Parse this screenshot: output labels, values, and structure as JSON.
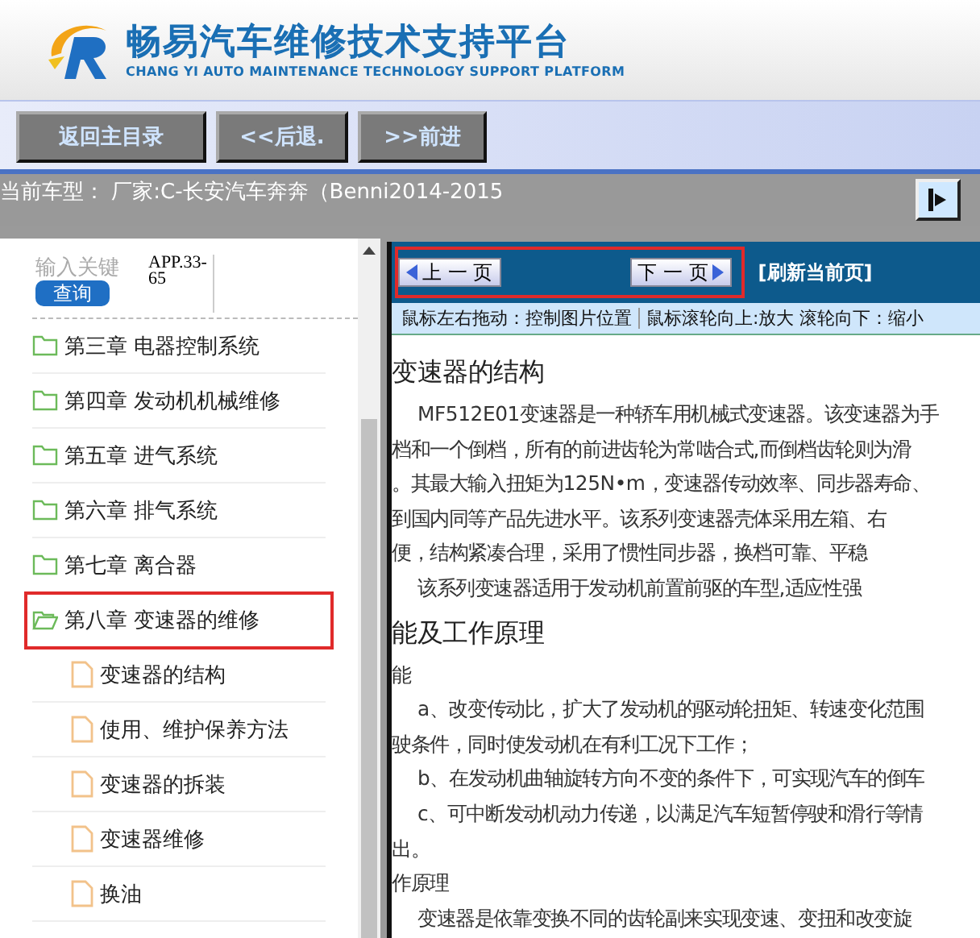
{
  "header": {
    "title": "畅易汽车维修技术支持平台",
    "subtitle": "CHANG YI AUTO MAINTENANCE TECHNOLOGY SUPPORT PLATFORM"
  },
  "nav_buttons": [
    "返回主目录",
    "<<后退.",
    ">>前进"
  ],
  "current_model": "当前车型：  厂家:C-长安汽车奔奔（Benni2014-2015",
  "search": {
    "placeholder": "输入关键",
    "button": "查询",
    "code": "APP.33-65"
  },
  "tree": [
    {
      "label": "第三章 电器控制系统",
      "expanded": false,
      "selected": false
    },
    {
      "label": "第四章 发动机机械维修",
      "expanded": false,
      "selected": false
    },
    {
      "label": "第五章 进气系统",
      "expanded": false,
      "selected": false
    },
    {
      "label": "第六章 排气系统",
      "expanded": false,
      "selected": false
    },
    {
      "label": "第七章 离合器",
      "expanded": false,
      "selected": false
    },
    {
      "label": "第八章 变速器的维修",
      "expanded": true,
      "selected": true,
      "children": [
        {
          "label": "变速器的结构"
        },
        {
          "label": "使用、维护保养方法"
        },
        {
          "label": "变速器的拆装"
        },
        {
          "label": "变速器维修"
        },
        {
          "label": "换油"
        }
      ]
    }
  ],
  "viewer": {
    "prev": "上 一 页",
    "next": "下 一 页",
    "pager_highlighted": true,
    "refresh": "[刷新当前页]",
    "hints": [
      "鼠标左右拖动：控制图片位置",
      "鼠标滚轮向上:放大  滚轮向下：缩小"
    ]
  },
  "document": [
    {
      "kind": "heading",
      "text": "变速器的结构"
    },
    {
      "kind": "indent",
      "text": "MF512E01变速器是一种轿车用机械式变速器。该变速器为手"
    },
    {
      "kind": "plain",
      "text": "档和一个倒档，所有的前进齿轮为常啮合式,而倒档齿轮则为滑"
    },
    {
      "kind": "plain",
      "text": "。其最大输入扭矩为125N•m，变速器传动效率、同步器寿命、"
    },
    {
      "kind": "plain",
      "text": "到国内同等产品先进水平。该系列变速器壳体采用左箱、右"
    },
    {
      "kind": "plain",
      "text": "便，结构紧凑合理，采用了惯性同步器，换档可靠、平稳"
    },
    {
      "kind": "indent",
      "text": "该系列变速器适用于发动机前置前驱的车型,适应性强"
    },
    {
      "kind": "heading",
      "text": "能及工作原理"
    },
    {
      "kind": "plain",
      "text": "能"
    },
    {
      "kind": "indent",
      "text": "a、改变传动比，扩大了发动机的驱动轮扭矩、转速变化范围"
    },
    {
      "kind": "plain",
      "text": "驶条件，同时使发动机在有利工况下工作；"
    },
    {
      "kind": "indent",
      "text": "b、在发动机曲轴旋转方向不变的条件下，可实现汽车的倒车"
    },
    {
      "kind": "indent",
      "text": "c、可中断发动机动力传递，以满足汽车短暂停驶和滑行等情"
    },
    {
      "kind": "plain",
      "text": "出。"
    },
    {
      "kind": "plain",
      "text": "作原理"
    },
    {
      "kind": "indent",
      "text": "变速器是依靠变换不同的齿轮副来实现变速、变扭和改变旋"
    }
  ]
}
